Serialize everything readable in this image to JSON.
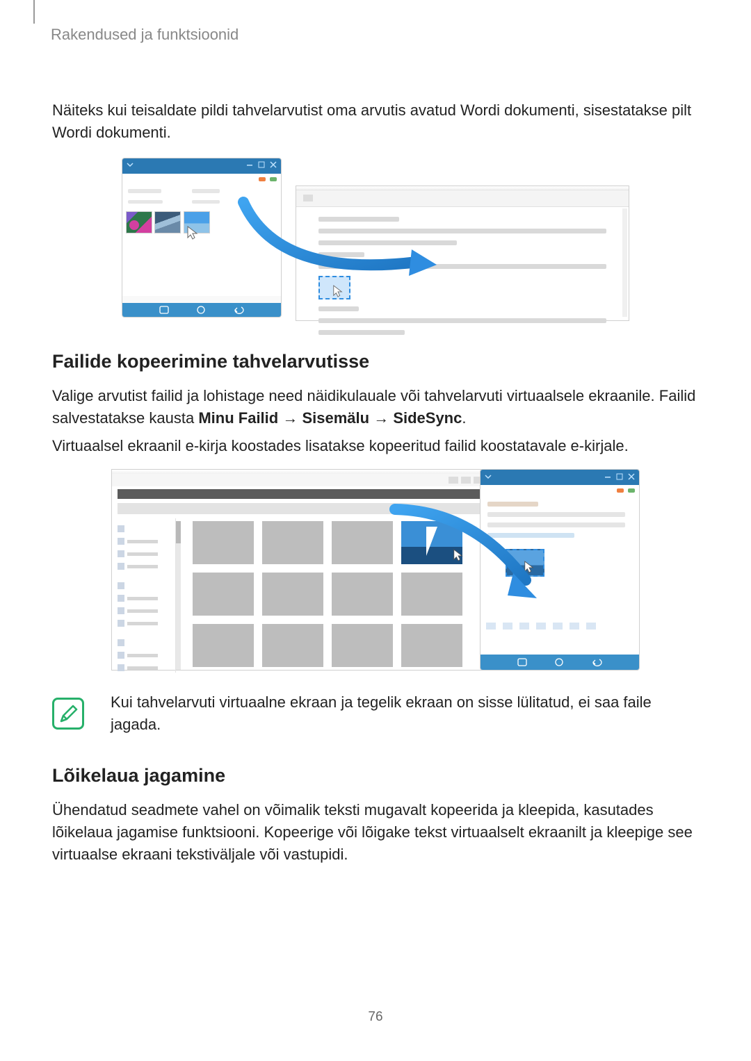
{
  "header": {
    "title": "Rakendused ja funktsioonid"
  },
  "intro": "Näiteks kui teisaldate pildi tahvelarvutist oma arvutis avatud Wordi dokumenti, sisestatakse pilt Wordi dokumenti.",
  "section1": {
    "heading": "Failide kopeerimine tahvelarvutisse",
    "p1_pre": "Valige arvutist failid ja lohistage need näidikulauale või tahvelarvuti virtuaalsele ekraanile. Failid salvestatakse kausta ",
    "bold1": "Minu Failid",
    "arrow": " → ",
    "bold2": "Sisemälu",
    "bold3": "SideSync",
    "period": ".",
    "p2": "Virtuaalsel ekraanil e-kirja koostades lisatakse kopeeritud failid koostatavale e-kirjale."
  },
  "note": {
    "text": "Kui tahvelarvuti virtuaalne ekraan ja tegelik ekraan on sisse lülitatud, ei saa faile jagada."
  },
  "section2": {
    "heading": "Lõikelaua jagamine",
    "p1": "Ühendatud seadmete vahel on võimalik teksti mugavalt kopeerida ja kleepida, kasutades lõikelaua jagamise funktsiooni. Kopeerige või lõigake tekst virtuaalselt ekraanilt ja kleepige see virtuaalse ekraani tekstiväljale või vastupidi."
  },
  "pageNumber": "76"
}
